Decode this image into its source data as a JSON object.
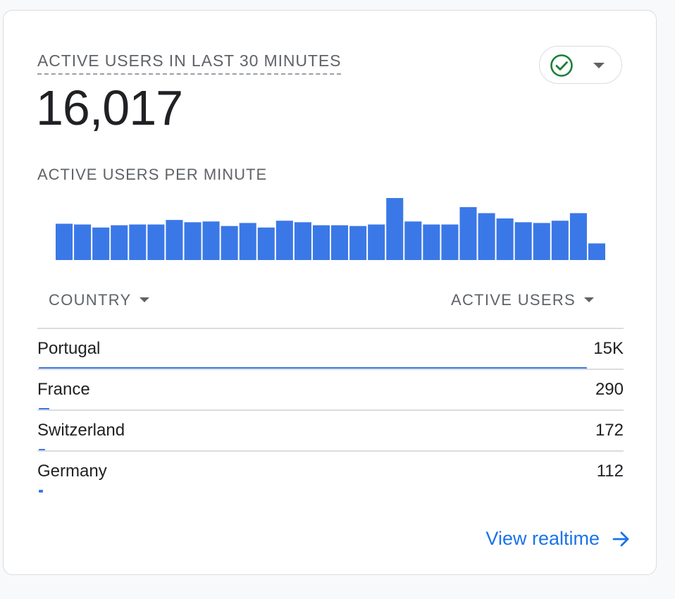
{
  "card": {
    "metric_title": "ACTIVE USERS IN LAST 30 MINUTES",
    "metric_value": "16,017",
    "status_icon": "check-circle-icon",
    "status_color": "#188038",
    "chart_title": "ACTIVE USERS PER MINUTE"
  },
  "chart_data": {
    "type": "bar",
    "title": "ACTIVE USERS PER MINUTE",
    "categories": [],
    "values": [
      48,
      47,
      43,
      46,
      47,
      47,
      53,
      50,
      51,
      45,
      49,
      43,
      52,
      50,
      46,
      46,
      45,
      47,
      82,
      51,
      47,
      47,
      70,
      62,
      55,
      50,
      49,
      52,
      62,
      22
    ],
    "ylim": [
      0,
      82
    ],
    "color": "#3b78e7",
    "grid": false
  },
  "table": {
    "col_country": "COUNTRY",
    "col_users": "ACTIVE USERS",
    "max_value": 15000,
    "rows": [
      {
        "country": "Portugal",
        "value_label": "15K",
        "value": 15000
      },
      {
        "country": "France",
        "value_label": "290",
        "value": 290
      },
      {
        "country": "Switzerland",
        "value_label": "172",
        "value": 172
      },
      {
        "country": "Germany",
        "value_label": "112",
        "value": 112
      }
    ]
  },
  "footer": {
    "link_label": "View realtime",
    "link_icon": "arrow-right-icon"
  },
  "colors": {
    "accent": "#1a73e8",
    "bar": "#3b78e7",
    "text_secondary": "#5f6368"
  }
}
